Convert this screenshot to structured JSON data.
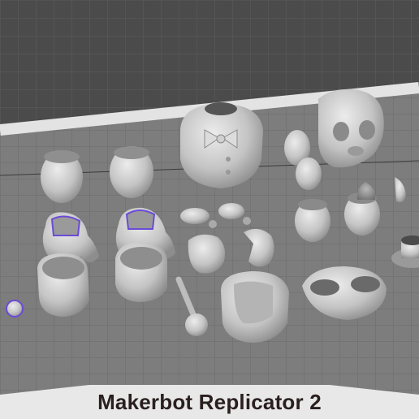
{
  "printer": {
    "name": "Makerbot Replicator 2"
  },
  "colors": {
    "background": "#4a4a4a",
    "plate": "#7d7d7d",
    "grid": "#6a6a6a",
    "plate_border": "#e3e3e3",
    "part": "#c9c9c9",
    "selection": "#6b4bd6",
    "label_text": "#2a1f1f"
  },
  "parts": [
    "hip-left",
    "torso-front-left",
    "torso-back-left",
    "hip-right",
    "torso-front-right",
    "torso-back-right",
    "chest-bowtie",
    "head-skull",
    "neck-piece",
    "shoulder-joint-a",
    "shoulder-joint-b",
    "hand-open",
    "hand-fist",
    "arm-rod",
    "jaw",
    "small-shell-a",
    "small-shell-b",
    "small-shell-c",
    "small-shell-d",
    "half-sphere-left",
    "half-sphere-right",
    "top-hat",
    "mask-ring",
    "small-sphere"
  ]
}
